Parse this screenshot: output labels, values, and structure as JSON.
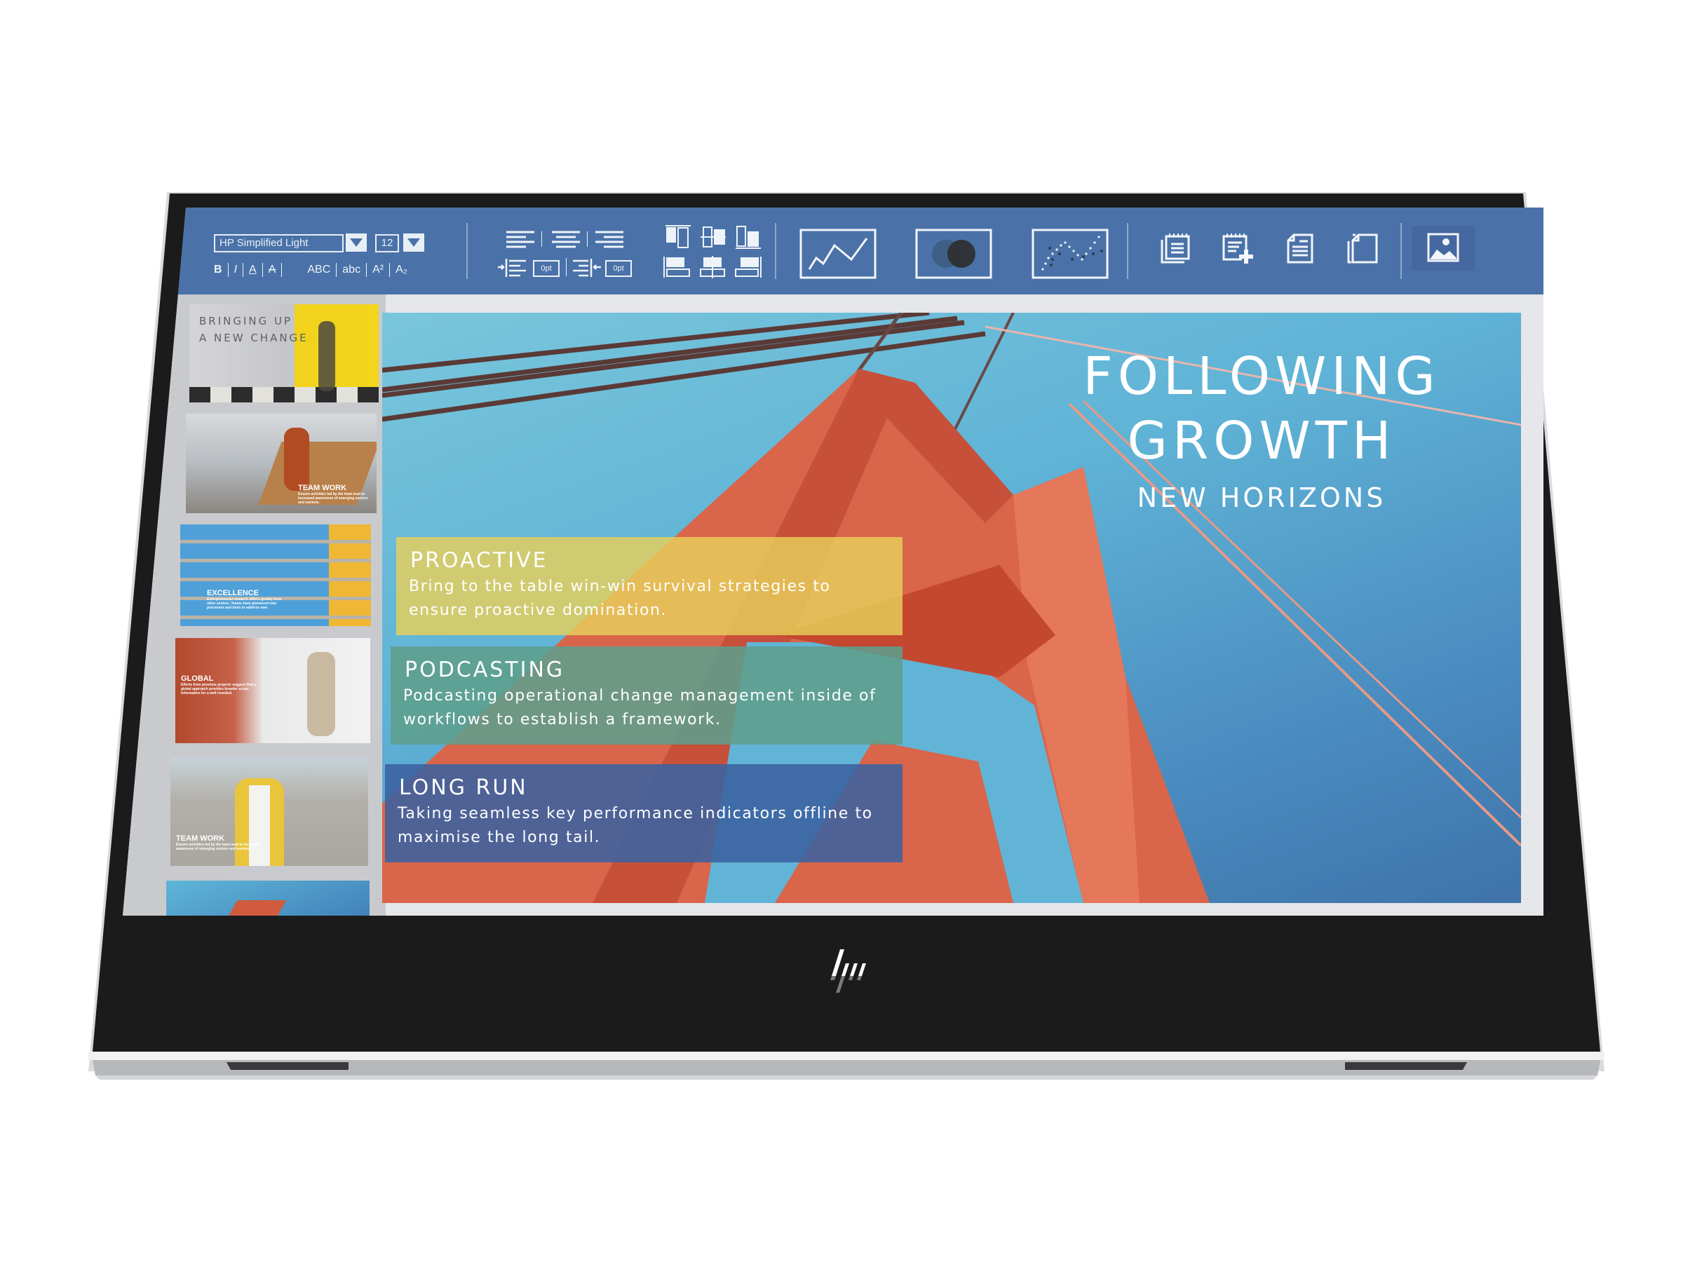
{
  "device": {
    "brand_logo": "hp-logo",
    "colors": {
      "bezel": "#1b1b1b",
      "frame": "#c8c9cc",
      "toolbar": "#4a72a8",
      "panel": "#c9cacd"
    }
  },
  "toolbar": {
    "font_family_value": "HP Simplified Light",
    "font_size_value": "12",
    "format_buttons": [
      {
        "label": "B",
        "name": "bold"
      },
      {
        "label": "I",
        "name": "italic"
      },
      {
        "label": "A",
        "name": "underline"
      },
      {
        "label": "A",
        "name": "strikethrough"
      }
    ],
    "case_buttons": [
      {
        "label": "ABC",
        "name": "uppercase"
      },
      {
        "label": "abc",
        "name": "lowercase"
      },
      {
        "label": "A²",
        "name": "superscript"
      },
      {
        "label": "A₂",
        "name": "subscript"
      }
    ],
    "indent_left_value": "0pt",
    "indent_right_value": "0pt",
    "align_icons": [
      "align-left-icon",
      "align-center-icon",
      "align-right-icon"
    ],
    "distribute_icons": [
      "align-top-icon",
      "align-middle-icon",
      "align-bottom-icon",
      "align-objects-left-icon",
      "align-objects-center-icon",
      "align-objects-right-icon"
    ],
    "chart_icons": [
      "line-chart-icon",
      "venn-diagram-icon",
      "scatter-chart-icon"
    ],
    "page_icons": [
      "notes-pages-icon",
      "add-note-icon",
      "document-icon",
      "duplicate-page-icon"
    ],
    "insert_icons": [
      "insert-image-icon"
    ]
  },
  "thumbnails": [
    {
      "title_line1": "BRINGING UP",
      "title_line2": "A NEW CHANGE"
    },
    {
      "caption_title": "TEAM WORK",
      "caption_body": "Ensure activities led by the team lead to increased awareness of emerging sectors and markets."
    },
    {
      "caption_title": "EXCELLENCE",
      "caption_body": "Entrepreneurial research differs greatly from other sectors. Teams have pioneered new processes and tools to address new"
    },
    {
      "caption_title": "GLOBAL",
      "caption_body": "Efforts from previous projects suggest that a global approach provides broader scope information for a well rounded."
    },
    {
      "caption_title": "TEAM WORK",
      "caption_body": "Ensure activities led by the team lead to increased awareness of emerging sectors and markets."
    },
    {
      "caption_title": "",
      "caption_body": ""
    }
  ],
  "slide": {
    "title_line1": "FOLLOWING",
    "title_line2": "GROWTH",
    "subtitle": "NEW HORIZONS",
    "boxes": [
      {
        "heading": "PROACTIVE",
        "body": "Bring to the table win-win survival strategies to ensure proactive domination.",
        "color": "#e8cf5a"
      },
      {
        "heading": "PODCASTING",
        "body": "Podcasting operational change management inside of workflows to establish a framework.",
        "color": "#5f9e8c"
      },
      {
        "heading": "LONG RUN",
        "body": "Taking seamless key performance indicators offline to maximise the long tail.",
        "color": "#3a62a0"
      }
    ]
  }
}
